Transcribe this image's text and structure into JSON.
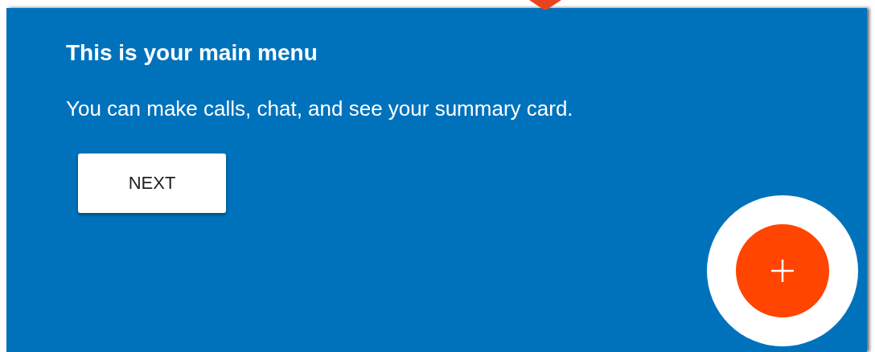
{
  "tooltip": {
    "title": "This is your main menu",
    "text": "You can make calls, chat, and see your summary card.",
    "button": "NEXT"
  }
}
